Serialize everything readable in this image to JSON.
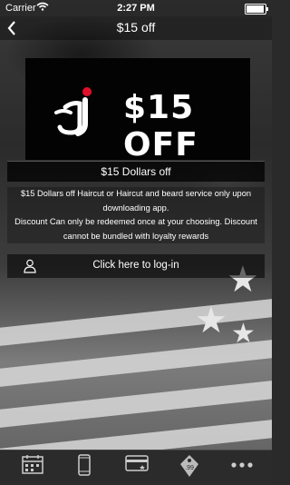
{
  "status_bar": {
    "carrier": "Carrier",
    "time": "2:27 PM",
    "battery_level": 0.95
  },
  "nav": {
    "title": "$15 off"
  },
  "banner": {
    "text": "$15 OFF",
    "accent_color": "#e0102b"
  },
  "offer": {
    "title": "$15 Dollars off",
    "line1": "$15 Dollars off Haircut or Haircut and beard service only upon downloading app.",
    "line2": "Discount Can only be redeemed once at your choosing. Discount cannot be bundled with loyalty rewards"
  },
  "login": {
    "label": "Click here to log-in"
  },
  "tabs": [
    {
      "icon": "calendar-icon"
    },
    {
      "icon": "phone-icon"
    },
    {
      "icon": "credit-card-icon"
    },
    {
      "icon": "price-tag-icon"
    },
    {
      "icon": "more-icon"
    }
  ]
}
